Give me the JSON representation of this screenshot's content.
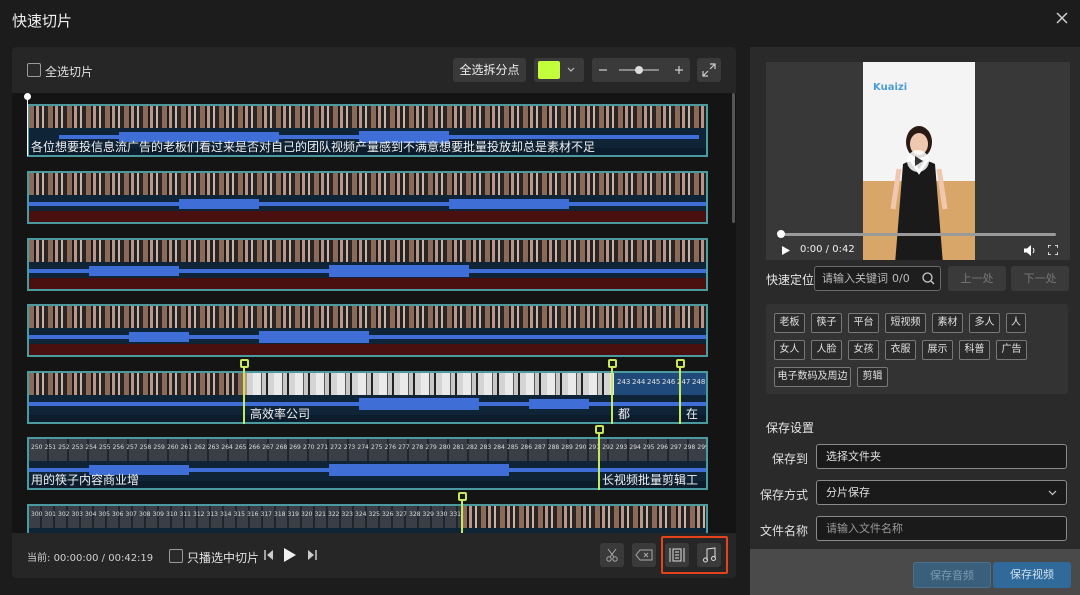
{
  "dialog": {
    "title": "快速切片"
  },
  "toolbar": {
    "select_all_label": "全选切片",
    "select_all_split_label": "全选拆分点",
    "marker_color": "#c3ff3a"
  },
  "clips": [
    {
      "subtitles": [
        {
          "text": "各位想要投信息流广告的老板们看过来是否对自己的团队视频产量感到不满意想要批量投放却总是素材不足"
        }
      ]
    },
    {
      "subtitles": []
    },
    {
      "subtitles": []
    },
    {
      "subtitles": []
    },
    {
      "subtitles": [
        {
          "text": "高效率公司"
        },
        {
          "text": "都"
        },
        {
          "text": "在"
        }
      ],
      "frame_numbers": [
        "243",
        "244",
        "245",
        "246",
        "247",
        "248"
      ]
    },
    {
      "subtitles": [
        {
          "text": "用的筷子内容商业增"
        },
        {
          "text": "长视频批量剪辑工"
        }
      ],
      "frame_numbers": [
        "250",
        "251",
        "252",
        "253",
        "254",
        "255",
        "256",
        "257",
        "258",
        "259",
        "260",
        "261",
        "262",
        "263",
        "264",
        "265",
        "266",
        "267",
        "268",
        "269",
        "270",
        "271",
        "272",
        "273",
        "274",
        "275",
        "276",
        "277",
        "278",
        "279",
        "280",
        "281",
        "282",
        "283",
        "284",
        "285",
        "286",
        "287",
        "288",
        "289",
        "290",
        "291",
        "292",
        "293",
        "294",
        "295",
        "296",
        "297",
        "298",
        "299"
      ]
    },
    {
      "subtitles": [],
      "frame_numbers": [
        "300",
        "301",
        "302",
        "303",
        "304",
        "305",
        "306",
        "307",
        "308",
        "309",
        "310",
        "311",
        "312",
        "313",
        "314",
        "315",
        "316",
        "317",
        "318",
        "319",
        "320",
        "321",
        "322",
        "323",
        "324",
        "325",
        "326",
        "327",
        "328",
        "329",
        "330",
        "331"
      ]
    }
  ],
  "bottom": {
    "current_label": "当前:",
    "current_time": "00:00:00",
    "separator": "/",
    "total_time": "00:42:19",
    "play_selected_label": "只播选中切片"
  },
  "player": {
    "logo": "Kuaizi",
    "current": "0:00",
    "separator": "/",
    "duration": "0:42"
  },
  "locate": {
    "label": "快速定位",
    "placeholder": "请输入关键词",
    "count": "0/0",
    "prev_label": "上一处",
    "next_label": "下一处"
  },
  "tags": [
    "老板",
    "筷子",
    "平台",
    "短视频",
    "素材",
    "多人",
    "人",
    "女人",
    "人脸",
    "女孩",
    "衣服",
    "展示",
    "科普",
    "广告",
    "电子数码及周边",
    "剪辑"
  ],
  "save_settings": {
    "title": "保存设置",
    "save_to_label": "保存到",
    "save_to_value": "选择文件夹",
    "method_label": "保存方式",
    "method_value": "分片保存",
    "filename_label": "文件名称",
    "filename_placeholder": "请输入文件名称",
    "save_audio_label": "保存音频",
    "save_video_label": "保存视频"
  }
}
